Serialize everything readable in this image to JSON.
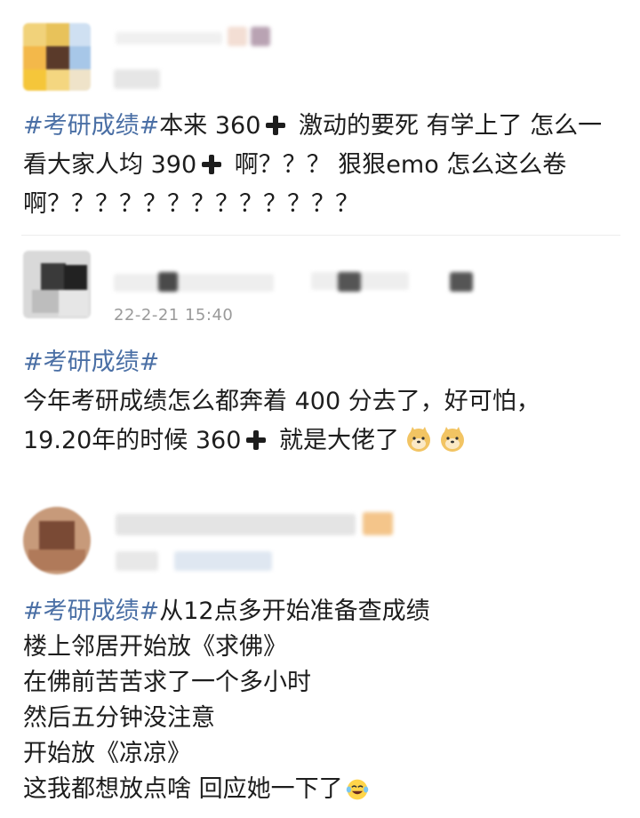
{
  "posts": [
    {
      "hashtag": "#考研成绩#",
      "text_a": "本来 360",
      "text_b": " 激动的要死 有学上了 怎么一看大家人均 390",
      "text_c": " 啊？？？ 狠狠emo 怎么这么卷啊？？？？？？？？？？？？？"
    },
    {
      "timestamp": "22-2-21 15:40",
      "hashtag": "#考研成绩#",
      "line1": "今年考研成绩怎么都奔着 400 分去了，好可怕，",
      "line2_a": "19.20年的时候 360",
      "line2_b": " 就是大佬了"
    },
    {
      "hashtag": "#考研成绩#",
      "line1_rest": "从12点多开始准备查成绩",
      "line2": "楼上邻居开始放《求佛》",
      "line3": "在佛前苦苦求了一个多小时",
      "line4": "然后五分钟没注意",
      "line5": "开始放《凉凉》",
      "line6": "这我都想放点啥 回应她一下了"
    }
  ],
  "icons": {
    "plus": "heavy-plus-icon",
    "doge": "doge-emoji-icon",
    "laugh_cry": "laugh-cry-emoji-icon"
  },
  "colors": {
    "hashtag": "#4a6fa5",
    "timestamp": "#9a9a9a"
  }
}
